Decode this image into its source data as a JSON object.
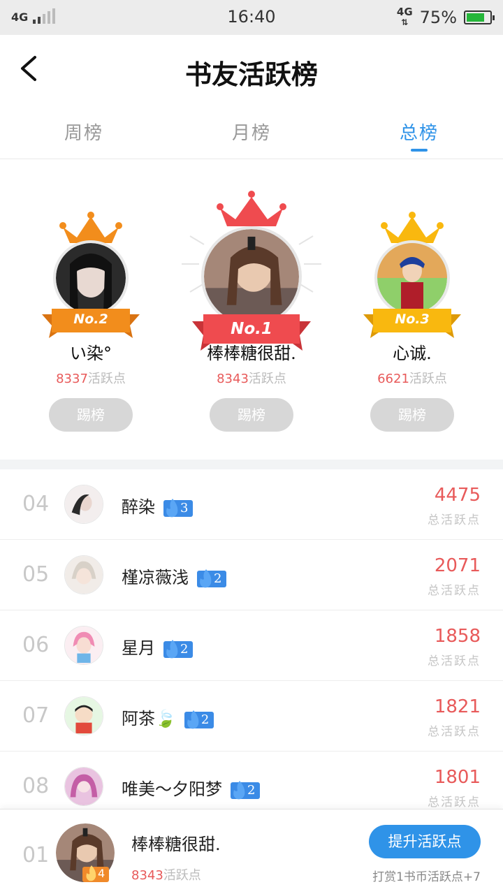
{
  "status_bar": {
    "network_left": "4G",
    "time": "16:40",
    "network_right": "4G",
    "battery": "75%"
  },
  "header": {
    "title": "书友活跃榜"
  },
  "tabs": [
    {
      "label": "周榜",
      "active": false
    },
    {
      "label": "月榜",
      "active": false
    },
    {
      "label": "总榜",
      "active": true
    }
  ],
  "podium": [
    {
      "badge": "No.2",
      "name": "い染°",
      "points": "8337",
      "unit": "活跃点",
      "button": "踢榜"
    },
    {
      "badge": "No.1",
      "name": "棒棒糖很甜.",
      "points": "8343",
      "unit": "活跃点",
      "button": "踢榜"
    },
    {
      "badge": "No.3",
      "name": "心诚.",
      "points": "6621",
      "unit": "活跃点",
      "button": "踢榜"
    }
  ],
  "list": [
    {
      "rank": "04",
      "name": "醉染",
      "level": "3",
      "score": "4475",
      "label": "总活跃点"
    },
    {
      "rank": "05",
      "name": "槿凉薇浅",
      "level": "2",
      "score": "2071",
      "label": "总活跃点"
    },
    {
      "rank": "06",
      "name": "星月",
      "level": "2",
      "score": "1858",
      "label": "总活跃点"
    },
    {
      "rank": "07",
      "name": "阿茶🍃",
      "level": "2",
      "score": "1821",
      "label": "总活跃点"
    },
    {
      "rank": "08",
      "name": "唯美～夕阳梦",
      "level": "2",
      "score": "1801",
      "label": "总活跃点"
    }
  ],
  "footer": {
    "rank": "01",
    "level": "4",
    "name": "棒棒糖很甜.",
    "points": "8343",
    "unit": "活跃点",
    "button": "提升活跃点",
    "tip": "打赏1书币活跃点+7"
  },
  "colors": {
    "accent": "#2f93e8",
    "score_red": "#e85a5a",
    "crown_gold": "#f9a20f",
    "crown_red": "#ef4b4f",
    "crown_orange": "#f28d1c"
  }
}
